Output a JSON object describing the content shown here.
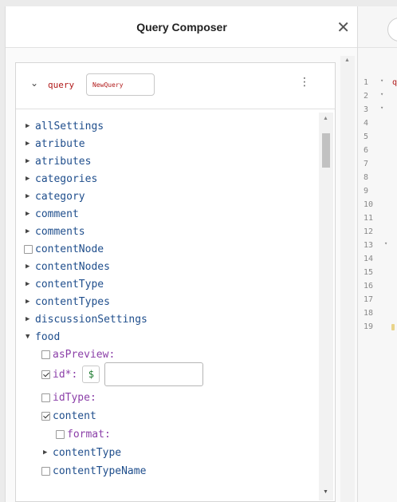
{
  "panel": {
    "title": "Query Composer",
    "close_icon": "✕"
  },
  "query": {
    "keyword": "query",
    "name": "NewQuery",
    "menu_icon": "⋮",
    "toggle_icon": "chevron-down"
  },
  "tree": [
    {
      "label": "allSettings",
      "kind": "expandable"
    },
    {
      "label": "atribute",
      "kind": "expandable"
    },
    {
      "label": "atributes",
      "kind": "expandable"
    },
    {
      "label": "categories",
      "kind": "expandable"
    },
    {
      "label": "category",
      "kind": "expandable"
    },
    {
      "label": "comment",
      "kind": "expandable"
    },
    {
      "label": "comments",
      "kind": "expandable"
    },
    {
      "label": "contentNode",
      "kind": "checkbox"
    },
    {
      "label": "contentNodes",
      "kind": "expandable"
    },
    {
      "label": "contentType",
      "kind": "expandable"
    },
    {
      "label": "contentTypes",
      "kind": "expandable"
    },
    {
      "label": "discussionSettings",
      "kind": "expandable"
    },
    {
      "label": "food",
      "kind": "expanded"
    },
    {
      "label": "asPreview:",
      "kind": "arg"
    },
    {
      "label": "id*:",
      "kind": "arg-checked",
      "variable_symbol": "$"
    },
    {
      "label": "idType:",
      "kind": "arg"
    },
    {
      "label": "content",
      "kind": "field-checked"
    },
    {
      "label": "format:",
      "kind": "arg"
    },
    {
      "label": "contentType",
      "kind": "expandable"
    },
    {
      "label": "contentTypeName",
      "kind": "checkbox"
    }
  ],
  "editor": {
    "line_numbers": [
      "1",
      "2",
      "3",
      "4",
      "5",
      "6",
      "7",
      "8",
      "9",
      "10",
      "11",
      "12",
      "13",
      "14",
      "15",
      "16",
      "17",
      "18",
      "19"
    ],
    "fold_lines": [
      "1",
      "2",
      "3",
      "12"
    ],
    "fold_marker": "▾",
    "peek_text": "q"
  },
  "colors": {
    "field": "#1f4e8c",
    "argument": "#8b3fa8",
    "keyword": "#b11a1a",
    "variable": "#1d7a2f"
  }
}
